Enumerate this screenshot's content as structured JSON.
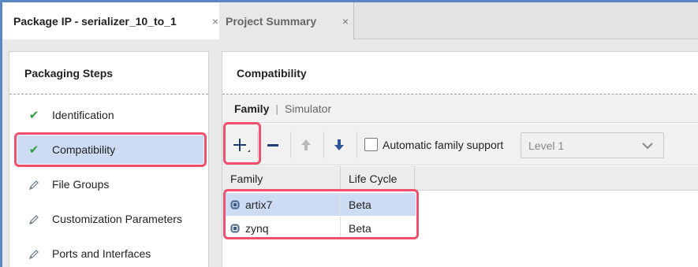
{
  "tabs": [
    {
      "label": "Package IP - serializer_10_to_1",
      "active": true,
      "close": "×"
    },
    {
      "label": "Project Summary",
      "active": false,
      "close": "×"
    }
  ],
  "packaging_steps": {
    "title": "Packaging Steps",
    "items": [
      {
        "label": "Identification",
        "icon": "check-icon",
        "selected": false
      },
      {
        "label": "Compatibility",
        "icon": "check-icon",
        "selected": true
      },
      {
        "label": "File Groups",
        "icon": "pencil-icon",
        "selected": false
      },
      {
        "label": "Customization Parameters",
        "icon": "pencil-icon",
        "selected": false
      },
      {
        "label": "Ports and Interfaces",
        "icon": "pencil-icon",
        "selected": false
      }
    ]
  },
  "compatibility": {
    "title": "Compatibility",
    "subtabs": [
      {
        "label": "Family",
        "active": true
      },
      {
        "label": "Simulator",
        "active": false
      }
    ],
    "toolbar": {
      "auto_family_label": "Automatic family support",
      "auto_family_checked": false,
      "level_value": "Level 1"
    },
    "table": {
      "columns": [
        "Family",
        "Life Cycle"
      ],
      "rows": [
        {
          "family": "artix7",
          "life_cycle": "Beta",
          "selected": true
        },
        {
          "family": "zynq",
          "life_cycle": "Beta",
          "selected": false
        }
      ]
    }
  },
  "colors": {
    "accent_blue": "#5b86c4",
    "selection": "#cddcf3",
    "highlight_red": "#f0506e",
    "check_green": "#2e9e3f",
    "arrow_blue": "#2f5597"
  }
}
